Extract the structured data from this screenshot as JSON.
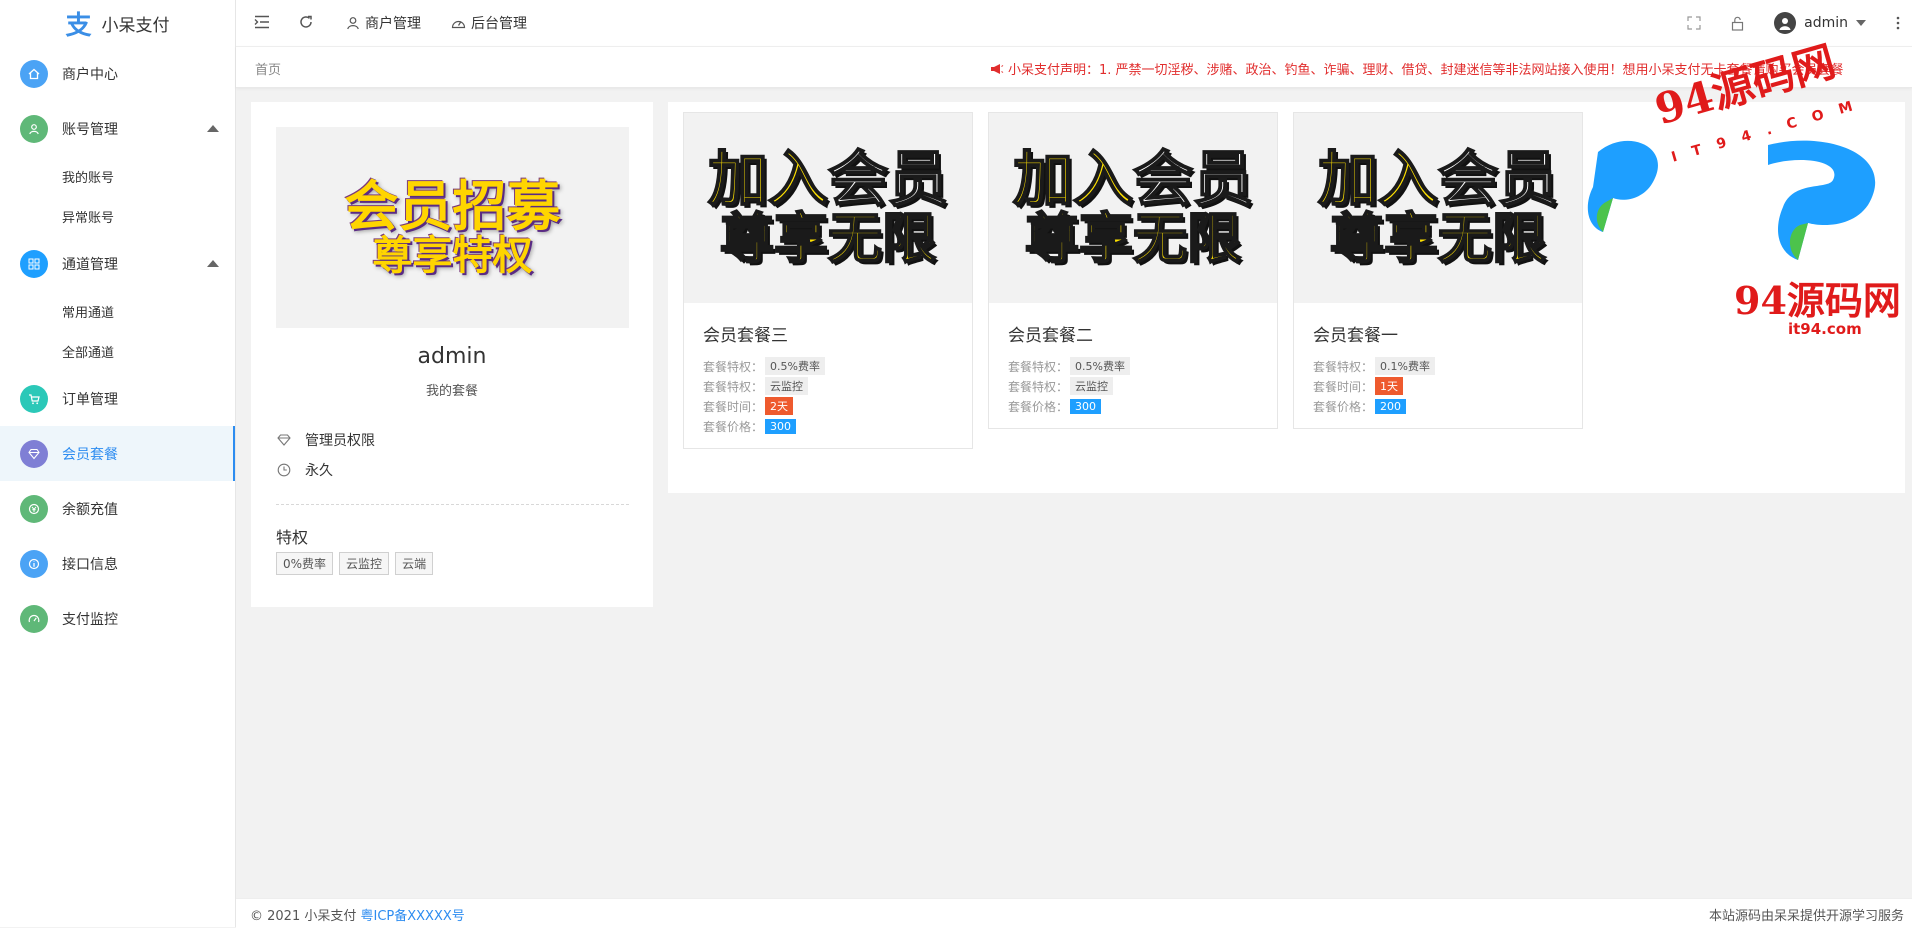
{
  "app": {
    "title": "小呆支付"
  },
  "sidebar": {
    "items": [
      {
        "label": "商户中心",
        "icon": "home-icon",
        "color": "#4ba3f5"
      },
      {
        "label": "账号管理",
        "icon": "user-icon",
        "color": "#5fb878",
        "expanded": true,
        "children": [
          {
            "label": "我的账号"
          },
          {
            "label": "异常账号"
          }
        ]
      },
      {
        "label": "通道管理",
        "icon": "channel-icon",
        "color": "#1e9fff",
        "expanded": true,
        "children": [
          {
            "label": "常用通道"
          },
          {
            "label": "全部通道"
          }
        ]
      },
      {
        "label": "订单管理",
        "icon": "cart-icon",
        "color": "#2bc8b8"
      },
      {
        "label": "会员套餐",
        "icon": "diamond-icon",
        "color": "#7f7fd5",
        "active": true
      },
      {
        "label": "余额充值",
        "icon": "coin-icon",
        "color": "#5fb878"
      },
      {
        "label": "接口信息",
        "icon": "info-icon",
        "color": "#4ba3f5"
      },
      {
        "label": "支付监控",
        "icon": "gauge-icon",
        "color": "#5fb878"
      }
    ]
  },
  "header": {
    "nav": [
      {
        "label": "商户管理",
        "icon": "user-outline-icon"
      },
      {
        "label": "后台管理",
        "icon": "dashboard-icon"
      }
    ],
    "user": {
      "name": "admin"
    }
  },
  "breadcrumb": {
    "home": "首页"
  },
  "notice": {
    "text": "小呆支付声明：1. 严禁一切淫秽、涉赌、政治、钓鱼、诈骗、理财、借贷、封建迷信等非法网站接入使用！想用小呆支付无卡套餐请购买会员套餐"
  },
  "profile": {
    "banner_line1": "会员招募",
    "banner_line2": "尊享特权",
    "name": "admin",
    "subtitle": "我的套餐",
    "permission": "管理员权限",
    "duration": "永久",
    "privileges_title": "特权",
    "privileges": [
      "0%费率",
      "云监控",
      "云端"
    ]
  },
  "packages": {
    "labels": {
      "privilege": "套餐特权：",
      "time": "套餐时间：",
      "price": "套餐价格："
    },
    "image_line1_a": "加入",
    "image_line1_b": "会员",
    "image_line2": "尊享无限",
    "items": [
      {
        "name": "会员套餐三",
        "privileges": [
          "0.5%费率",
          "云监控"
        ],
        "time": "2天",
        "price": "300"
      },
      {
        "name": "会员套餐二",
        "privileges": [
          "0.5%费率",
          "云监控"
        ],
        "time": "",
        "price": "300"
      },
      {
        "name": "会员套餐一",
        "privileges": [
          "0.1%费率"
        ],
        "time": "1天",
        "price": "200"
      }
    ]
  },
  "watermark": {
    "text": "94源码网",
    "domain_top": "IT94.COM",
    "domain": "it94.com"
  },
  "footer": {
    "copyright": "© 2021 小呆支付",
    "icp": "粤ICP备XXXXX号",
    "right": "本站源码由呆呆提供开源学习服务"
  }
}
